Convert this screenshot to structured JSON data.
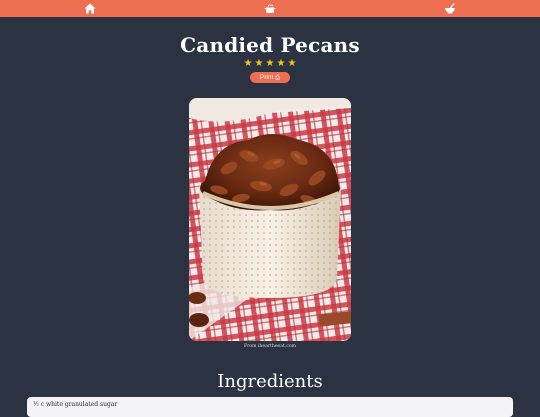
{
  "nav": {
    "items": [
      {
        "icon": "home-icon"
      },
      {
        "icon": "cooking-pot-icon"
      },
      {
        "icon": "mixing-bowl-icon"
      }
    ],
    "bar_color": "#ee6e51"
  },
  "recipe": {
    "title": "Candied Pecans",
    "rating": {
      "value": 5,
      "max": 5,
      "stars": [
        "★",
        "★",
        "★",
        "★",
        "★"
      ]
    },
    "print_label": "Print",
    "image_credit": "From iheartheeat.com",
    "photo_subject": "candied pecans in a bowl"
  },
  "ingredients": {
    "heading": "Ingredients",
    "items": [
      "½ c white granulated sugar"
    ]
  },
  "colors": {
    "background": "#2b3242",
    "accent": "#ee6e51",
    "star": "#f5c518"
  }
}
